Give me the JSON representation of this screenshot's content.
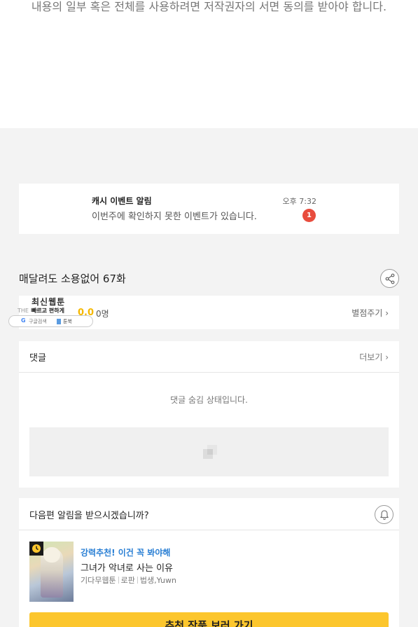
{
  "notice": {
    "text": "내용의 일부 혹은 전체를 사용하려면 저작권자의 서면 동의를 받아야 합니다."
  },
  "alarm": {
    "title": "캐시 이벤트 알림",
    "message": "이번주에 확인하지 못한 이벤트가 있습니다.",
    "time": "오후 7:32",
    "badge_count": "1"
  },
  "episode": {
    "title": "매달려도 소용없어 67화",
    "share_icon": "share-icon"
  },
  "rating": {
    "score": "0.0",
    "count": "0명",
    "rate_link": "별점주기 ›"
  },
  "overlay": {
    "title": "최신웹툰",
    "sub_left": "THE 빠르고",
    "sub_right": "빠르고 편하게",
    "google_label": "구글검색",
    "book_label": "툰북"
  },
  "comments": {
    "label": "댓글",
    "more_link": "더보기 ›",
    "hidden_message": "댓글 숨김 상태입니다."
  },
  "next_episode": {
    "label": "다음편 알림을 받으시겠습니까?",
    "bell_icon": "bell-icon"
  },
  "recommendation": {
    "tag": "강력추천! 이건 꼭 봐야해",
    "title": "그녀가 악녀로 사는 이유",
    "meta": [
      "기다무웹툰",
      "로판",
      "법생,Yuwn"
    ],
    "button_label": "추천 작품 보러 가기"
  },
  "colors": {
    "accent_yellow": "#fcc62d",
    "badge_red": "#e84c3d",
    "link_blue": "#2a7fd4"
  }
}
